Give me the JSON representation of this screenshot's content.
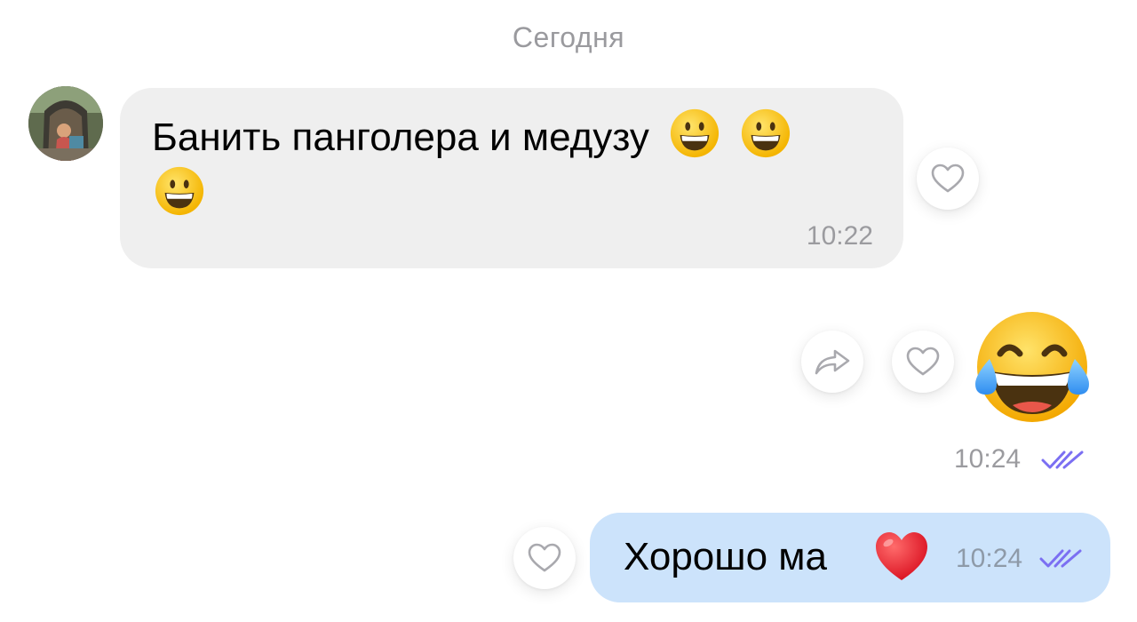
{
  "date_separator": "Сегодня",
  "incoming_message": {
    "text": "Банить панголера и медузу",
    "emojis": [
      "grinning-face-emoji",
      "grinning-face-emoji",
      "grinning-face-emoji"
    ],
    "time": "10:22"
  },
  "outgoing_emoji_message": {
    "emoji": "face-with-tears-of-joy-emoji",
    "time": "10:24",
    "status": "read"
  },
  "outgoing_text_message": {
    "text": "Хорошо ма",
    "emoji": "red-heart-emoji",
    "time": "10:24",
    "status": "read"
  },
  "colors": {
    "incoming_bubble": "#efefef",
    "outgoing_bubble": "#cce3fb",
    "read_ticks": "#7b6ff2",
    "meta_text": "#9b9b9f"
  },
  "icons": {
    "like": "heart-outline-icon",
    "share": "share-arrow-icon",
    "read_status": "double-check-icon"
  }
}
